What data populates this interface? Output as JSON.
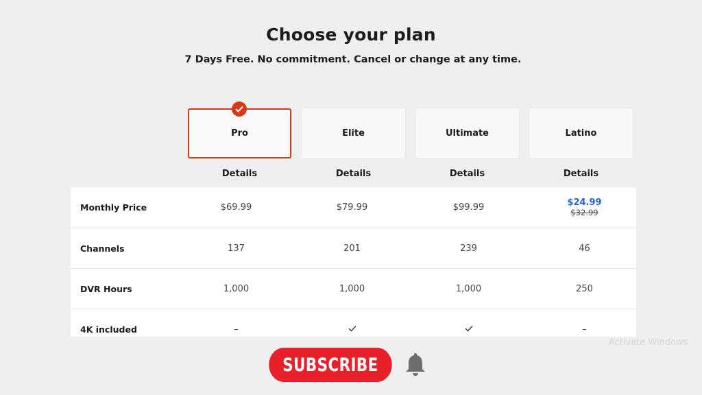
{
  "header": {
    "title": "Choose your plan",
    "subtitle": "7 Days Free. No commitment. Cancel or change at any time."
  },
  "plans": [
    {
      "name": "Pro",
      "selected": true,
      "details_label": "Details"
    },
    {
      "name": "Elite",
      "selected": false,
      "details_label": "Details"
    },
    {
      "name": "Ultimate",
      "selected": false,
      "details_label": "Details"
    },
    {
      "name": "Latino",
      "selected": false,
      "details_label": "Details"
    }
  ],
  "table": {
    "rows": [
      {
        "label": "Monthly Price",
        "cells": [
          {
            "value": "$69.99"
          },
          {
            "value": "$79.99"
          },
          {
            "value": "$99.99"
          },
          {
            "value": "$24.99",
            "original": "$32.99"
          }
        ]
      },
      {
        "label": "Channels",
        "cells": [
          {
            "value": "137"
          },
          {
            "value": "201"
          },
          {
            "value": "239"
          },
          {
            "value": "46"
          }
        ]
      },
      {
        "label": "DVR Hours",
        "cells": [
          {
            "value": "1,000"
          },
          {
            "value": "1,000"
          },
          {
            "value": "1,000"
          },
          {
            "value": "250"
          }
        ]
      },
      {
        "label": "4K included",
        "cells": [
          {
            "value": "–"
          },
          {
            "icon": "check-icon"
          },
          {
            "icon": "check-icon"
          },
          {
            "value": "–"
          }
        ]
      }
    ]
  },
  "overlay": {
    "subscribe_label": "SUBSCRIBE",
    "bell_icon": "bell-icon",
    "watermark": "Activate Windows"
  },
  "colors": {
    "accent": "#d63a14",
    "sale_price": "#2461d4",
    "subscribe_bg": "#e8202a",
    "background": "#efefef"
  }
}
